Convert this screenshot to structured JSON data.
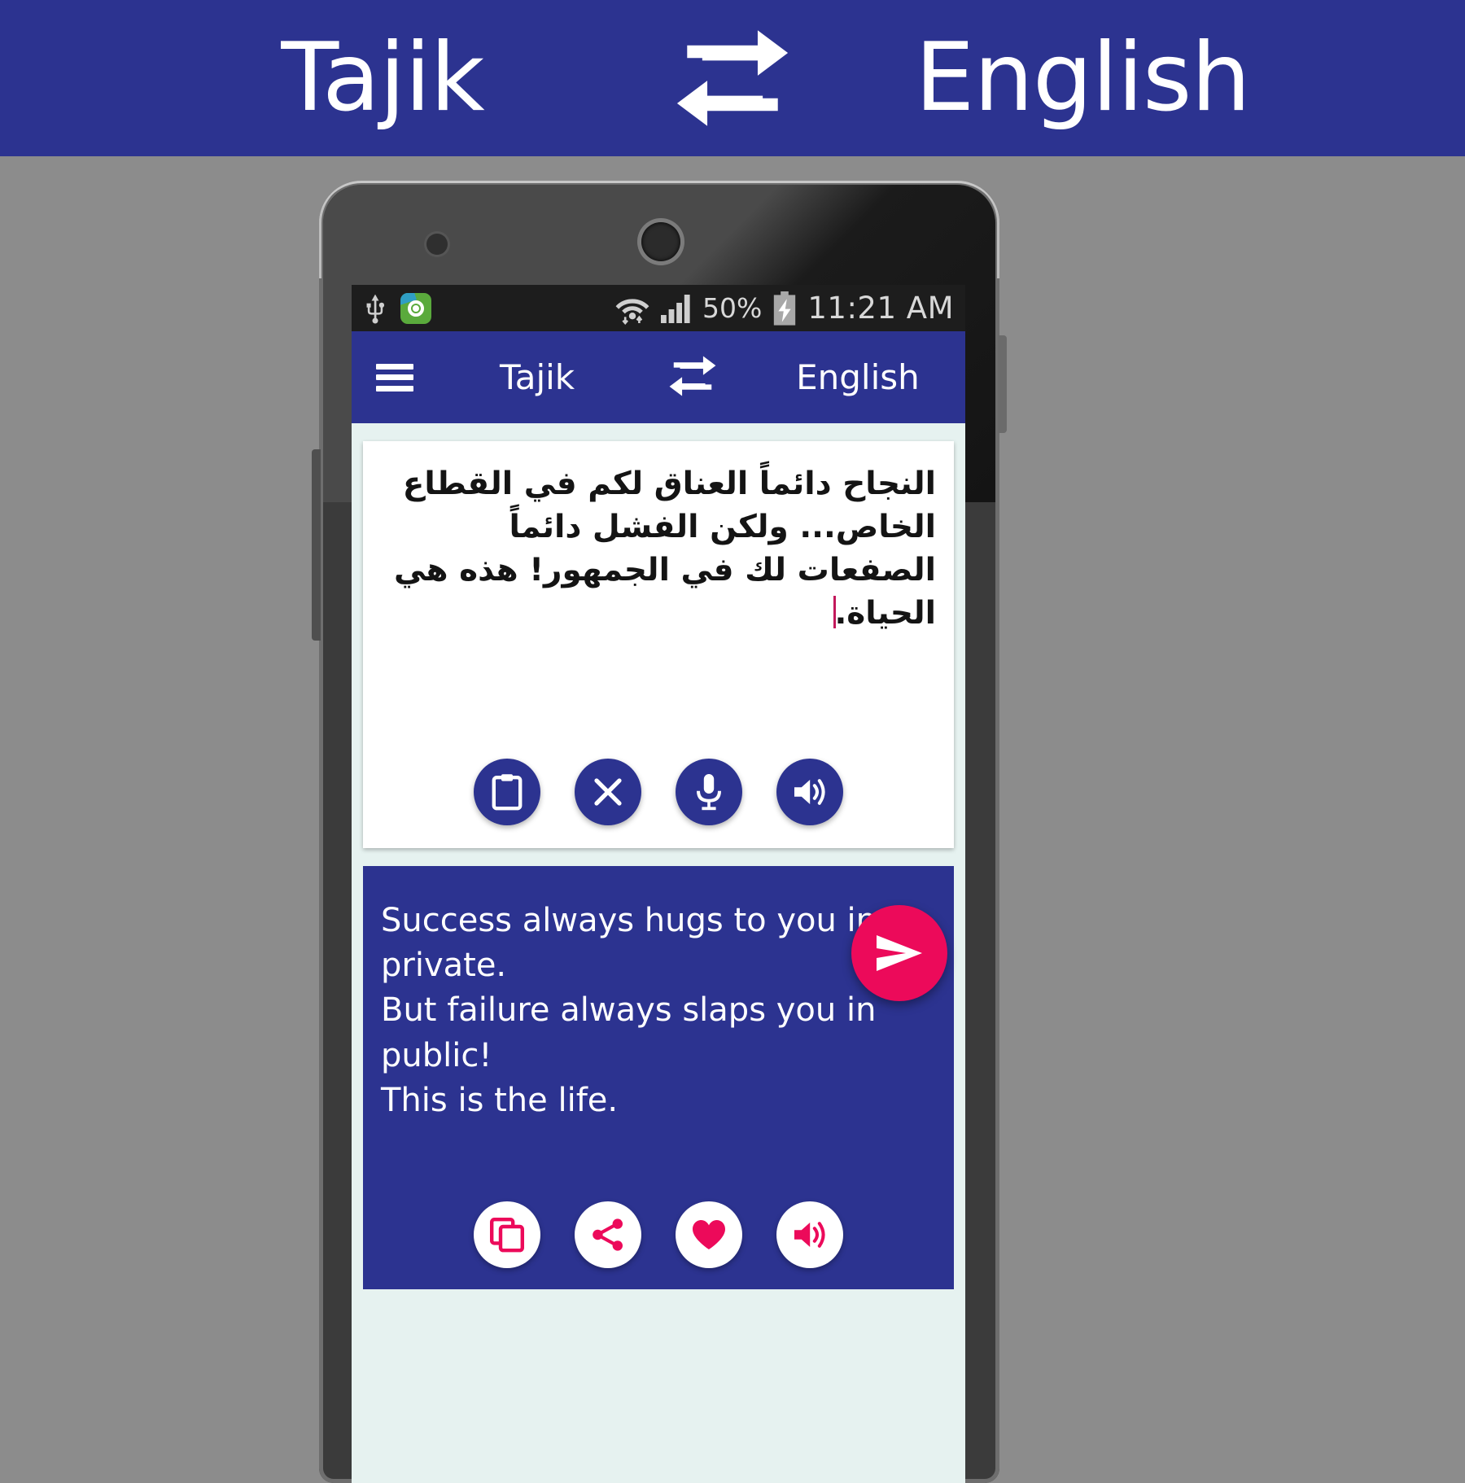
{
  "banner": {
    "source_language": "Tajik",
    "target_language": "English",
    "swap_icon": "swap-arrows-icon",
    "background_color": "#2c3390",
    "text_color": "#ffffff"
  },
  "phone": {
    "status_bar": {
      "usb_icon": "usb-icon",
      "app_icon": "location-app-icon",
      "wifi_icon": "wifi-icon",
      "signal_icon": "cellular-signal-icon",
      "battery_percent": "50%",
      "battery_icon": "battery-charging-icon",
      "time": "11:21 AM",
      "background_color": "#1d1d1d"
    },
    "toolbar": {
      "menu_icon": "hamburger-menu-icon",
      "source_language": "Tajik",
      "swap_icon": "swap-arrows-icon",
      "target_language": "English",
      "background_color": "#2c3390"
    },
    "source_card": {
      "text": "النجاح دائماً العناق لكم في القطاع الخاص... ولكن الفشل دائماً الصفعات لك في الجمهور! هذه هي الحياة.",
      "actions": [
        {
          "name": "paste-button",
          "icon": "clipboard-icon"
        },
        {
          "name": "clear-button",
          "icon": "close-x-icon"
        },
        {
          "name": "voice-input-button",
          "icon": "microphone-icon"
        },
        {
          "name": "speak-source-button",
          "icon": "speaker-icon"
        }
      ]
    },
    "translate_fab": {
      "icon": "send-icon",
      "color": "#ec0a5a"
    },
    "result_card": {
      "text": "Success always hugs to you in private.\nBut failure always slaps you in public!\nThis is the life.",
      "background_color": "#2c3390",
      "actions": [
        {
          "name": "copy-button",
          "icon": "copy-icon"
        },
        {
          "name": "share-button",
          "icon": "share-icon"
        },
        {
          "name": "favorite-button",
          "icon": "heart-icon"
        },
        {
          "name": "speak-result-button",
          "icon": "speaker-icon"
        }
      ]
    }
  },
  "colors": {
    "primary_blue": "#2c3390",
    "accent_pink": "#ec0a5a",
    "page_background": "#8c8c8c",
    "screen_background": "#e6f2f0"
  }
}
